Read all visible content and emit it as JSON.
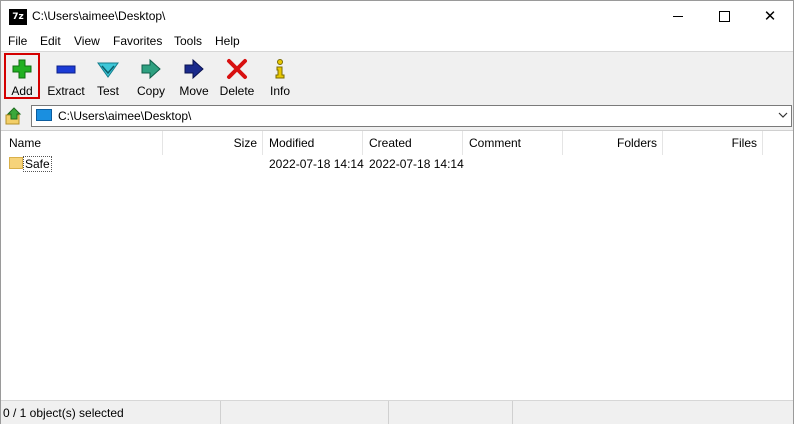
{
  "window": {
    "title": "C:\\Users\\aimee\\Desktop\\",
    "app_icon_text": "7z"
  },
  "menu": [
    "File",
    "Edit",
    "View",
    "Favorites",
    "Tools",
    "Help"
  ],
  "toolbar": {
    "add": "Add",
    "extract": "Extract",
    "test": "Test",
    "copy": "Copy",
    "move": "Move",
    "delete": "Delete",
    "info": "Info"
  },
  "address": {
    "path": "C:\\Users\\aimee\\Desktop\\"
  },
  "columns": {
    "name": "Name",
    "size": "Size",
    "modified": "Modified",
    "created": "Created",
    "comment": "Comment",
    "folders": "Folders",
    "files": "Files"
  },
  "rows": [
    {
      "name": "Safe",
      "size": "",
      "modified": "2022-07-18 14:14",
      "created": "2022-07-18 14:14",
      "comment": "",
      "folders": "",
      "files": ""
    }
  ],
  "status": {
    "selection": "0 / 1 object(s) selected"
  },
  "colors": {
    "highlight_border": "#d40000",
    "toolbar_bg": "#f0f0f0"
  }
}
